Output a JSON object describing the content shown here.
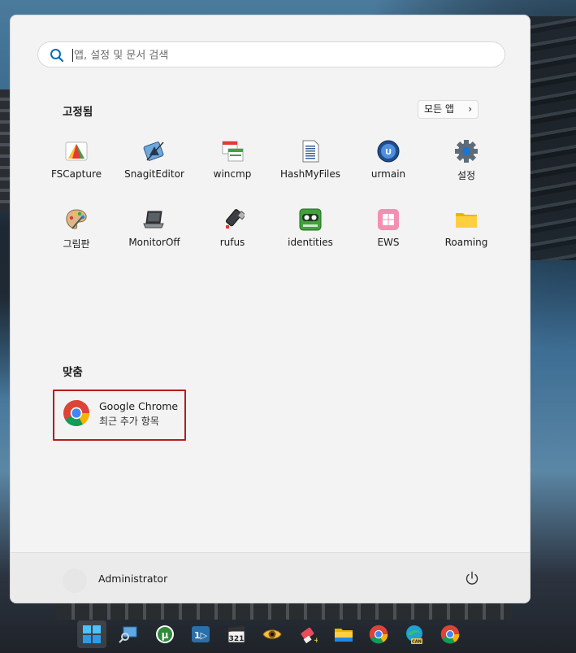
{
  "search": {
    "placeholder": "앱, 설정 및 문서 검색"
  },
  "pinned": {
    "title": "고정됨",
    "all_apps_label": "모든 앱",
    "apps": [
      {
        "label": "FSCapture",
        "icon": "fscapture-icon"
      },
      {
        "label": "SnagitEditor",
        "icon": "snagit-editor-icon"
      },
      {
        "label": "wincmp",
        "icon": "wincmp-icon"
      },
      {
        "label": "HashMyFiles",
        "icon": "hashmyfiles-icon"
      },
      {
        "label": "urmain",
        "icon": "urmain-icon"
      },
      {
        "label": "설정",
        "icon": "settings-gear-icon"
      },
      {
        "label": "그림판",
        "icon": "paint-palette-icon"
      },
      {
        "label": "MonitorOff",
        "icon": "monitoroff-laptop-icon"
      },
      {
        "label": "rufus",
        "icon": "rufus-usb-icon"
      },
      {
        "label": "identities",
        "icon": "identities-icon"
      },
      {
        "label": "EWS",
        "icon": "ews-windows-icon"
      },
      {
        "label": "Roaming",
        "icon": "folder-icon"
      }
    ]
  },
  "recommended": {
    "title": "맞춤",
    "items": [
      {
        "title": "Google Chrome",
        "subtitle": "최근 추가 항목",
        "icon": "chrome-icon"
      }
    ]
  },
  "footer": {
    "user_name": "Administrator",
    "power_icon": "power-icon"
  },
  "taskbar": {
    "items": [
      "start-windows-icon",
      "search-icon",
      "utorrent-icon",
      "app-1d-icon",
      "clapperboard-icon",
      "eye-viewer-icon",
      "eraser-icon",
      "file-explorer-icon",
      "chrome-icon",
      "edge-can-icon",
      "chrome-icon"
    ]
  },
  "colors": {
    "accent": "#0067c0",
    "highlight_border": "#b71c1c",
    "menu_bg": "#f3f3f3"
  }
}
